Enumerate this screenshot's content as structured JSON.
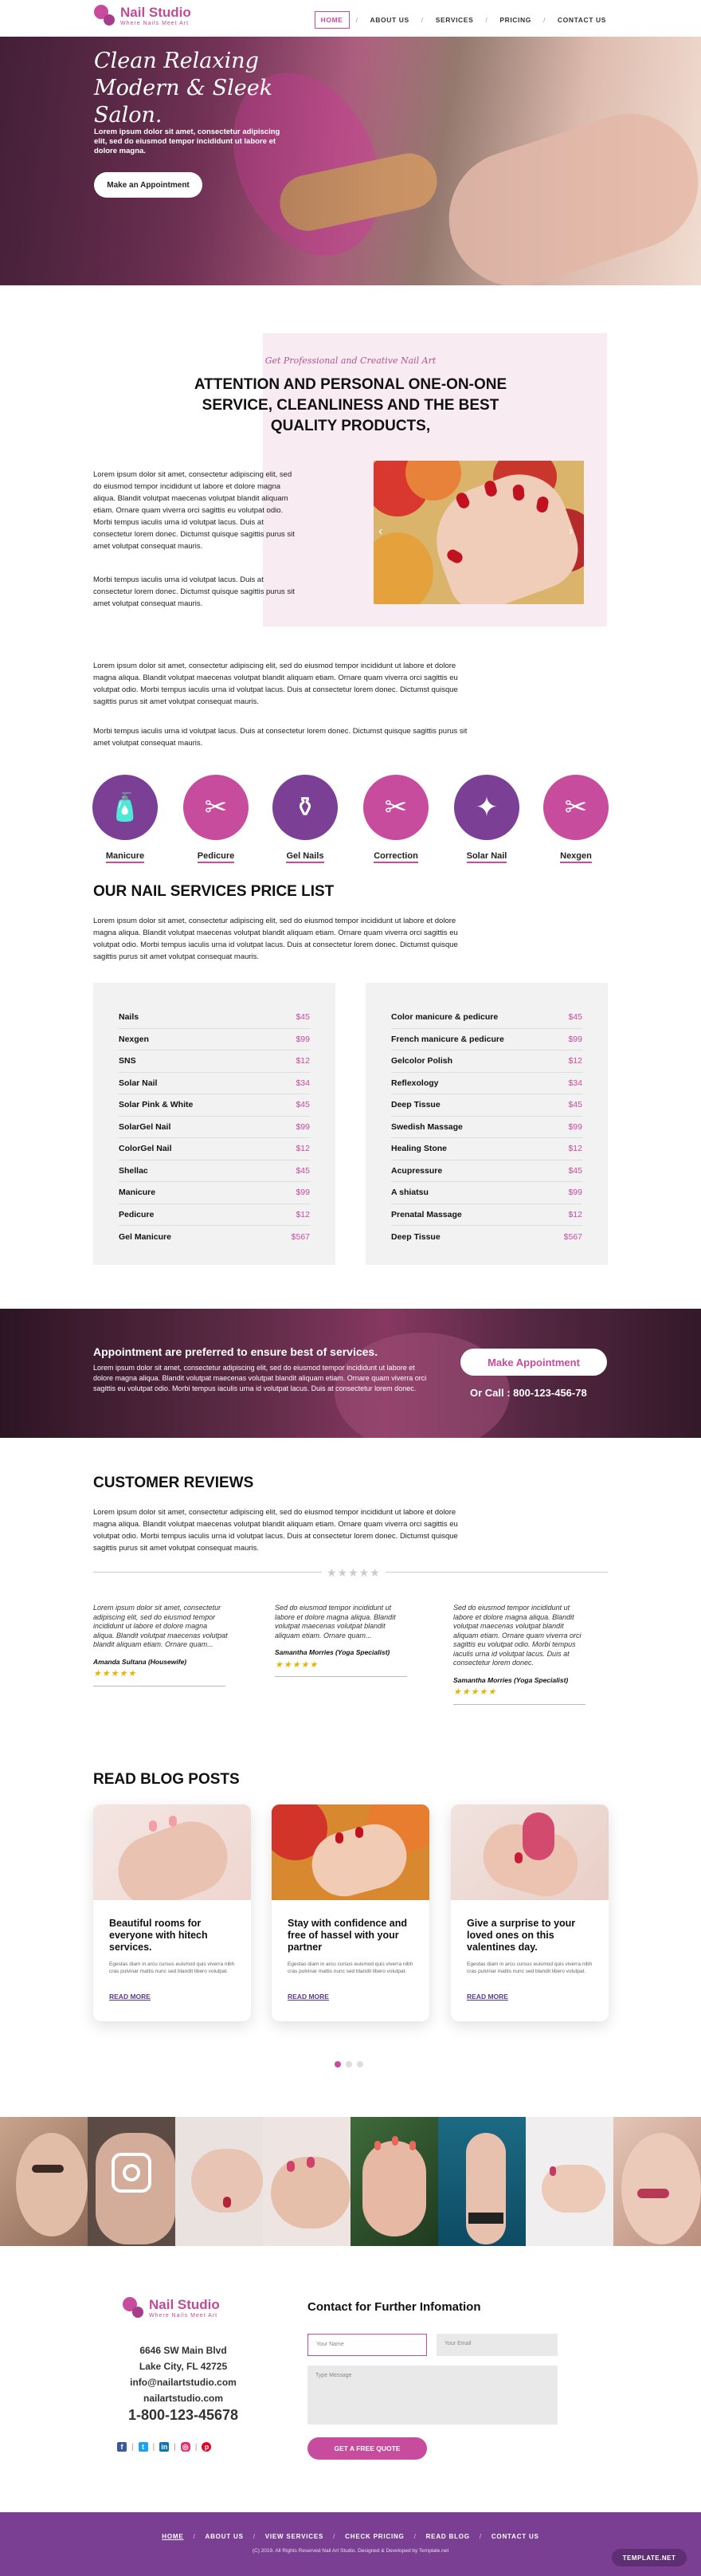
{
  "brand": {
    "name": "Nail Studio",
    "tagline": "Where Nails Meet Art"
  },
  "nav": {
    "home": "HOME",
    "about": "ABOUT US",
    "services": "SERVICES",
    "pricing": "PRICING",
    "contact": "CONTACT US",
    "sep": "/"
  },
  "hero": {
    "title": "Clean Relaxing Modern & Sleek Salon.",
    "text": "Lorem ipsum dolor sit amet, consectetur adipiscing elit, sed do eiusmod tempor incididunt ut labore et dolore magna.",
    "button": "Make an Appointment"
  },
  "intro": {
    "script": "Get Professional and Creative Nail Art",
    "title": "ATTENTION AND PERSONAL ONE-ON-ONE SERVICE, CLEANLINESS AND THE BEST QUALITY PRODUCTS,",
    "p1": "Lorem ipsum dolor sit amet, consectetur adipiscing elit, sed do eiusmod tempor incididunt ut labore et dolore magna aliqua. Blandit volutpat maecenas volutpat blandit aliquam etiam. Ornare quam viverra orci sagittis eu volutpat odio. Morbi tempus iaculis urna id volutpat lacus. Duis at consectetur lorem donec. Dictumst quisque sagittis purus sit amet volutpat consequat mauris.",
    "p2": "Morbi tempus iaculis urna id volutpat lacus. Duis at consectetur lorem donec. Dictumst quisque sagittis purus sit amet volutpat consequat mauris.",
    "p3": "Lorem ipsum dolor sit amet, consectetur adipiscing elit, sed do eiusmod tempor incididunt ut labore et dolore magna aliqua. Blandit volutpat maecenas volutpat blandit aliquam etiam. Ornare quam viverra orci sagittis eu volutpat odio. Morbi tempus iaculis urna id volutpat lacus. Duis at consectetur lorem donec. Dictumst quisque sagittis purus sit amet volutpat consequat mauris.",
    "p4": "Morbi tempus iaculis urna id volutpat lacus. Duis at consectetur lorem donec. Dictumst quisque sagittis purus sit amet volutpat consequat mauris.",
    "prev": "‹",
    "next": "›"
  },
  "services": [
    {
      "label": "Manicure",
      "icon": "nail-polish-bottle-icon",
      "glyph": "🧴",
      "color": "#7b3f95"
    },
    {
      "label": "Pedicure",
      "icon": "nail-clipper-icon",
      "glyph": "✂",
      "color": "#c84c9e"
    },
    {
      "label": "Gel Nails",
      "icon": "gel-polish-icon",
      "glyph": "⚱",
      "color": "#7b3f95"
    },
    {
      "label": "Correction",
      "icon": "scissors-icon",
      "glyph": "✂",
      "color": "#c84c9e"
    },
    {
      "label": "Solar Nail",
      "icon": "nail-art-icon",
      "glyph": "✦",
      "color": "#7b3f95"
    },
    {
      "label": "Nexgen",
      "icon": "cuticle-nipper-icon",
      "glyph": "✂",
      "color": "#c84c9e"
    }
  ],
  "price": {
    "title": "OUR NAIL SERVICES PRICE LIST",
    "text": "Lorem ipsum dolor sit amet, consectetur adipiscing elit, sed do eiusmod tempor incididunt ut labore et dolore magna aliqua. Blandit volutpat maecenas volutpat blandit aliquam etiam. Ornare quam viverra orci sagittis eu volutpat odio. Morbi tempus iaculis urna id volutpat lacus. Duis at consectetur lorem donec. Dictumst quisque sagittis purus sit amet volutpat consequat mauris.",
    "left": [
      {
        "name": "Nails",
        "price": "$45"
      },
      {
        "name": "Nexgen",
        "price": "$99"
      },
      {
        "name": "SNS",
        "price": "$12"
      },
      {
        "name": "Solar Nail",
        "price": "$34"
      },
      {
        "name": "Solar Pink & White",
        "price": "$45"
      },
      {
        "name": "SolarGel Nail",
        "price": "$99"
      },
      {
        "name": "ColorGel Nail",
        "price": "$12"
      },
      {
        "name": "Shellac",
        "price": "$45"
      },
      {
        "name": "Manicure",
        "price": "$99"
      },
      {
        "name": "Pedicure",
        "price": "$12"
      },
      {
        "name": "Gel Manicure",
        "price": "$567"
      }
    ],
    "right": [
      {
        "name": "Color manicure & pedicure",
        "price": "$45"
      },
      {
        "name": "French manicure & pedicure",
        "price": "$99"
      },
      {
        "name": "Gelcolor Polish",
        "price": "$12"
      },
      {
        "name": "Reflexology",
        "price": "$34"
      },
      {
        "name": "Deep Tissue",
        "price": "$45"
      },
      {
        "name": "Swedish Massage",
        "price": "$99"
      },
      {
        "name": "Healing Stone",
        "price": "$12"
      },
      {
        "name": "Acupressure",
        "price": "$45"
      },
      {
        "name": "A shiatsu",
        "price": "$99"
      },
      {
        "name": "Prenatal Massage",
        "price": "$12"
      },
      {
        "name": "Deep Tissue",
        "price": "$567"
      }
    ]
  },
  "banner": {
    "heading": "Appointment are preferred to ensure best of services.",
    "text": "Lorem ipsum dolor sit amet, consectetur adipiscing elit, sed do eiusmod tempor incididunt ut labore et dolore magna aliqua. Blandit volutpat maecenas volutpat blandit aliquam etiam. Ornare quam viverra orci sagittis eu volutpat odio. Morbi tempus iaculis urna id volutpat lacus. Duis at consectetur lorem donec.",
    "button": "Make Appointment",
    "call": "Or Call : 800-123-456-78"
  },
  "reviews": {
    "title": "CUSTOMER REVIEWS",
    "text": "Lorem ipsum dolor sit amet, consectetur adipiscing elit, sed do eiusmod tempor incididunt ut labore et dolore magna aliqua. Blandit volutpat maecenas volutpat blandit aliquam etiam. Ornare quam viverra orci sagittis eu volutpat odio. Morbi tempus iaculis urna id volutpat lacus. Duis at consectetur lorem donec. Dictumst quisque sagittis purus sit amet volutpat consequat mauris.",
    "divider_stars": "★★★★★",
    "items": [
      {
        "text": "Lorem ipsum dolor sit amet, consectetur adipiscing elit, sed do eiusmod tempor incididunt ut labore et dolore magna aliqua. Blandit volutpat maecenas volutpat blandit aliquam etiam. Ornare quam...",
        "author": "Amanda Sultana (Housewife)",
        "stars": "★★★★★"
      },
      {
        "text": "Sed do eiusmod tempor incididunt ut labore et dolore magna aliqua. Blandit volutpat maecenas volutpat blandit aliquam etiam. Ornare quam...",
        "author": "Samantha Morries (Yoga Specialist)",
        "stars": "★★★★★"
      },
      {
        "text": "Sed do eiusmod tempor incididunt ut labore et dolore magna aliqua. Blandit volutpat maecenas volutpat blandit aliquam etiam. Ornare quam viverra orci sagittis eu volutpat odio. Morbi tempus iaculis urna id volutpat lacus. Duis at consectetur lorem donec.",
        "author": "Samantha Morries (Yoga Specialist)",
        "stars": "★★★★★"
      }
    ]
  },
  "blog": {
    "title": "READ BLOG POSTS",
    "posts": [
      {
        "title": "Beautiful rooms for everyone with hitech services.",
        "desc": "Egestas diam in arcu cursus euismod quis viverra nibh cras pulvinar mattis nunc sed blandit libero volutpat.",
        "more": "READ MORE"
      },
      {
        "title": "Stay with confidence and free of hassel with your partner",
        "desc": "Egestas diam in arcu cursus euismod quis viverra nibh cras pulvinar mattis nunc sed blandit libero volutpat.",
        "more": "READ MORE"
      },
      {
        "title": "Give a surprise to your loved ones on this valentines day.",
        "desc": "Egestas diam in arcu cursus euismod quis viverra nibh cras pulvinar mattis nunc sed blandit libero volutpat.",
        "more": "READ MORE"
      }
    ]
  },
  "contact": {
    "address1": "6646 SW Main Blvd",
    "address2": "Lake City, FL 42725",
    "email": "info@nailartstudio.com",
    "site": "nailartstudio.com",
    "phone": "1-800-123-45678",
    "form_title": "Contact for Further Infomation",
    "name_ph": "Your Name",
    "email_ph": "Your Email",
    "msg_ph": "Type Message",
    "button": "GET A FREE QUOTE",
    "sep": "|"
  },
  "footer": {
    "nav": [
      "HOME",
      "ABOUT US",
      "VIEW SERVICES",
      "CHECK PRICING",
      "READ BLOG",
      "CONTACT US"
    ],
    "sep": "/",
    "copyright": "(C) 2019. All Rights Reserved Nail Art Studio. Designed & Developed by Template.net",
    "badge": "TEMPLATE.NET"
  },
  "colors": {
    "accent": "#c84c9e",
    "purple": "#7b3f95",
    "footer": "#7a3f92"
  }
}
